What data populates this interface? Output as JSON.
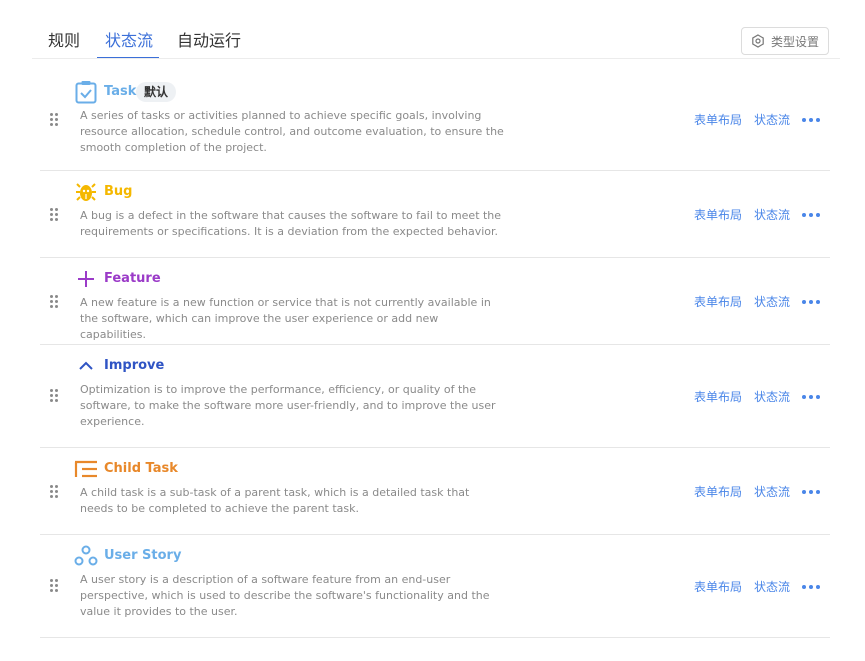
{
  "tabs": [
    {
      "label": "规则",
      "active": false
    },
    {
      "label": "状态流",
      "active": true
    },
    {
      "label": "自动运行",
      "active": false
    }
  ],
  "type_settings_label": "类型设置",
  "actions": {
    "form_layout": "表单布局",
    "workflow": "状态流"
  },
  "colors": {
    "accent": "#3b6fd8",
    "link": "#4a86e8"
  },
  "types": [
    {
      "name": "Task",
      "color": "#6aaee8",
      "icon": "clipboard-check-icon",
      "badge": "默认",
      "description": "A series of tasks or activities planned to achieve specific goals, involving resource allocation, schedule control, and outcome evaluation, to ensure the smooth completion of the project."
    },
    {
      "name": "Bug",
      "color": "#f5b800",
      "icon": "bug-icon",
      "description": "A bug is a defect in the software that causes the software to fail to meet the requirements or specifications. It is a deviation from the expected behavior."
    },
    {
      "name": "Feature",
      "color": "#9b3bc8",
      "icon": "plus-icon",
      "description": "A new feature is a new function or service that is not currently available in the software, which can improve the user experience or add new capabilities."
    },
    {
      "name": "Improve",
      "color": "#2f54c4",
      "icon": "chevron-up-icon",
      "description": "Optimization is to improve the performance, efficiency, or quality of the software, to make the software more user-friendly, and to improve the user experience."
    },
    {
      "name": "Child Task",
      "color": "#e8882a",
      "icon": "list-indent-icon",
      "description": "A child task is a sub-task of a parent task, which is a detailed task that needs to be completed to achieve the parent task."
    },
    {
      "name": "User Story",
      "color": "#6aaee8",
      "icon": "three-circles-icon",
      "description": "A user story is a description of a software feature from an end-user perspective, which is used to describe the software's functionality and the value it provides to the user."
    }
  ]
}
